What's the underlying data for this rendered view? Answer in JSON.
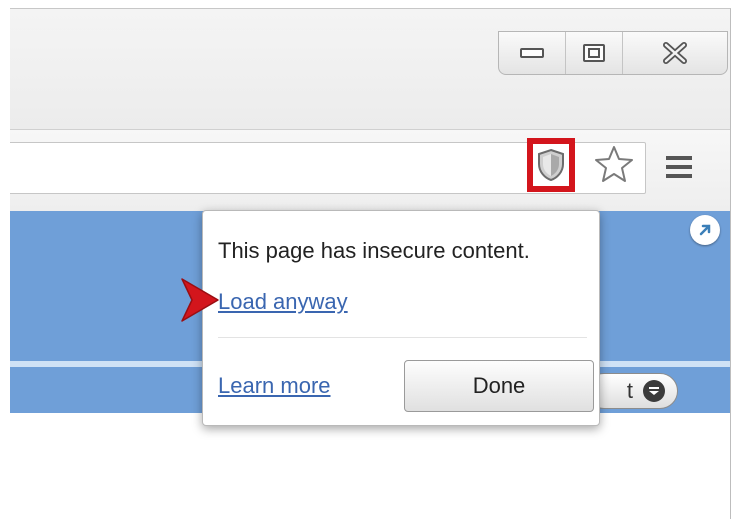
{
  "window_controls": [
    {
      "name": "minimize",
      "icon": "minimize-icon"
    },
    {
      "name": "maximize",
      "icon": "maximize-icon"
    },
    {
      "name": "close",
      "icon": "close-icon"
    }
  ],
  "toolbar": {
    "icons": [
      "insecure-content-shield-icon",
      "bookmark-star-icon",
      "menu-icon"
    ],
    "highlight_color": "#d3151c"
  },
  "popup": {
    "message": "This page has insecure content.",
    "load_anyway_link": "Load anyway",
    "learn_more_link": "Learn more",
    "done_button": "Done",
    "link_color": "#3a66b0"
  },
  "page": {
    "dropdown_partial_text": "t",
    "accent_color": "#6f9fd8"
  }
}
